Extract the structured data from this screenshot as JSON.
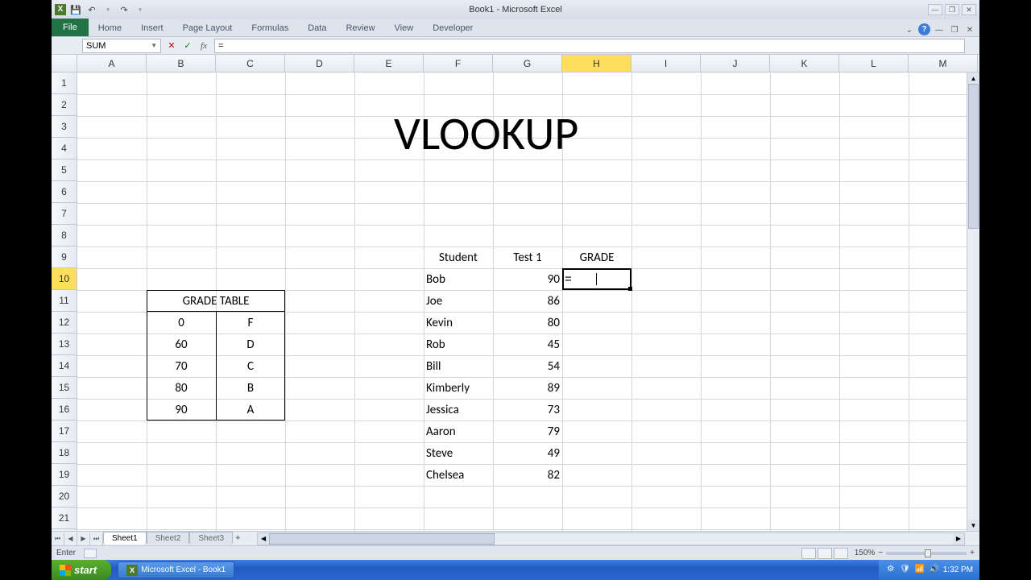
{
  "window": {
    "title": "Book1 - Microsoft Excel"
  },
  "qat": {
    "save": "💾",
    "undo": "↶",
    "redo": "↷"
  },
  "ribbon": {
    "file": "File",
    "tabs": [
      "Home",
      "Insert",
      "Page Layout",
      "Formulas",
      "Data",
      "Review",
      "View",
      "Developer"
    ]
  },
  "formula_bar": {
    "name_box": "SUM",
    "cancel": "✕",
    "enter": "✓",
    "fx": "fx",
    "value": "="
  },
  "columns": [
    "A",
    "B",
    "C",
    "D",
    "E",
    "F",
    "G",
    "H",
    "I",
    "J",
    "K",
    "L",
    "M"
  ],
  "active_col": "H",
  "rows": [
    "1",
    "2",
    "3",
    "4",
    "5",
    "6",
    "7",
    "8",
    "9",
    "10",
    "11",
    "12",
    "13",
    "14",
    "15",
    "16",
    "17",
    "18",
    "19",
    "20",
    "21"
  ],
  "active_row": "10",
  "big_word": "VLOOKUP",
  "grade_table": {
    "title": "GRADE TABLE",
    "rows": [
      {
        "score": "0",
        "letter": "F"
      },
      {
        "score": "60",
        "letter": "D"
      },
      {
        "score": "70",
        "letter": "C"
      },
      {
        "score": "80",
        "letter": "B"
      },
      {
        "score": "90",
        "letter": "A"
      }
    ]
  },
  "students": {
    "headers": {
      "name": "Student",
      "test": "Test 1",
      "grade": "GRADE"
    },
    "rows": [
      {
        "name": "Bob",
        "score": "90"
      },
      {
        "name": "Joe",
        "score": "86"
      },
      {
        "name": "Kevin",
        "score": "80"
      },
      {
        "name": "Rob",
        "score": "45"
      },
      {
        "name": "Bill",
        "score": "54"
      },
      {
        "name": "Kimberly",
        "score": "89"
      },
      {
        "name": "Jessica",
        "score": "73"
      },
      {
        "name": "Aaron",
        "score": "79"
      },
      {
        "name": "Steve",
        "score": "49"
      },
      {
        "name": "Chelsea",
        "score": "82"
      }
    ]
  },
  "active_cell_value": "=",
  "sheets": {
    "active": "Sheet1",
    "others": [
      "Sheet2",
      "Sheet3"
    ]
  },
  "status": {
    "mode": "Enter",
    "zoom": "150%"
  },
  "taskbar": {
    "start": "start",
    "item": "Microsoft Excel - Book1",
    "clock": "1:32 PM"
  }
}
